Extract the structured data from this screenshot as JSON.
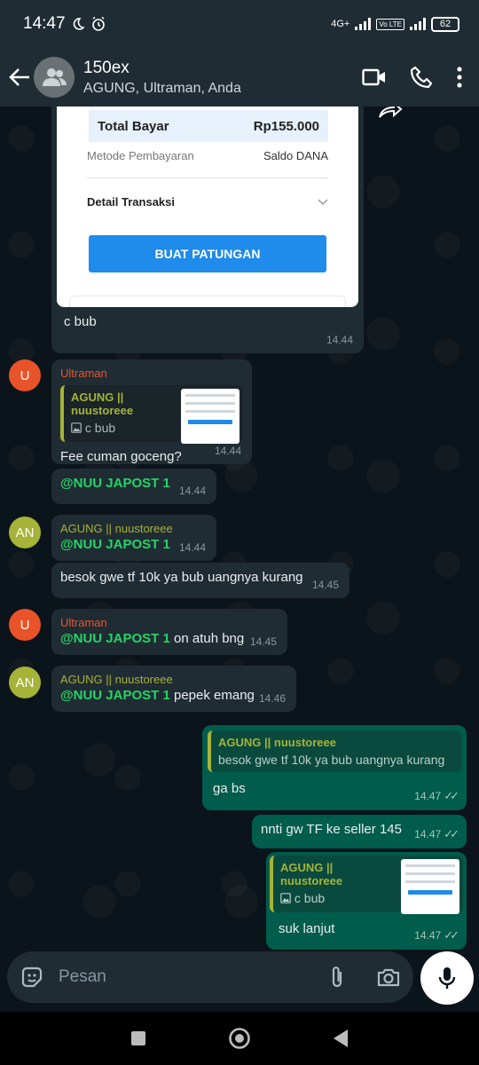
{
  "status": {
    "time": "14:47",
    "net": "4G+",
    "lte": "Vo LTE",
    "battery": "62"
  },
  "header": {
    "title": "150ex",
    "subtitle": "AGUNG, Ultraman, Anda"
  },
  "receipt": {
    "total_label": "Total Bayar",
    "total_value": "Rp155.000",
    "method_label": "Metode Pembayaran",
    "method_value": "Saldo DANA",
    "detail_label": "Detail Transaksi",
    "button_label": "BUAT PATUNGAN"
  },
  "messages": [
    {
      "text": "c bub",
      "time": "14.44"
    },
    {
      "sender": "Ultraman",
      "avatar": "U",
      "quote_name": "AGUNG || nuustoreee",
      "quote_text": "c bub",
      "text": "Fee cuman goceng?",
      "time": "14.44"
    },
    {
      "mention": "@NUU JAPOST 1",
      "time": "14.44"
    },
    {
      "sender": "AGUNG || nuustoreee",
      "avatar": "AN",
      "mention": "@NUU JAPOST 1",
      "time": "14.44"
    },
    {
      "text": "besok gwe tf 10k ya bub uangnya kurang",
      "time": "14.45"
    },
    {
      "sender": "Ultraman",
      "avatar": "U",
      "mention": "@NUU JAPOST 1",
      "text": " on atuh bng",
      "time": "14.45"
    },
    {
      "sender": "AGUNG || nuustoreee",
      "avatar": "AN",
      "mention": "@NUU JAPOST 1",
      "text": " pepek emang",
      "time": "14.46"
    },
    {
      "quote_name": "AGUNG || nuustoreee",
      "quote_text": "besok gwe tf 10k ya bub uangnya kurang",
      "text": "ga bs",
      "time": "14.47"
    },
    {
      "text": "nnti gw TF ke seller 145",
      "time": "14.47"
    },
    {
      "quote_name": "AGUNG || nuustoreee",
      "quote_text": "c bub",
      "text": "suk lanjut",
      "time": "14.47"
    }
  ],
  "composer": {
    "placeholder": "Pesan"
  },
  "colors": {
    "ultraman_avatar": "#e8532a",
    "agung_avatar": "#a5b337",
    "outgoing_bubble": "#005c4b",
    "incoming_bubble": "#202c33",
    "dana_blue": "#1f8bea"
  }
}
